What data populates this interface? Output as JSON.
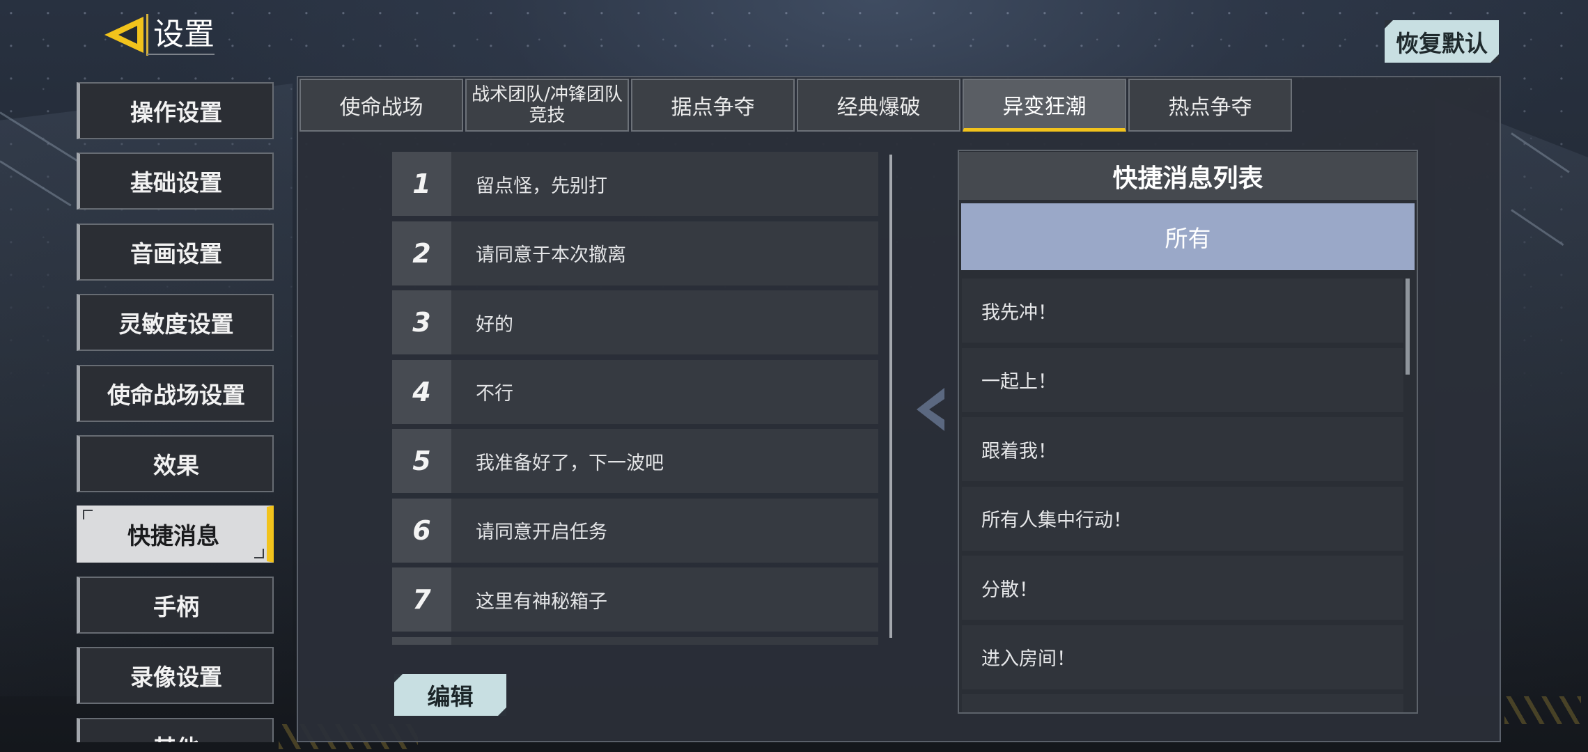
{
  "theme": {
    "accent": "#f2c31c",
    "filter_active": "#9aa8c8",
    "button_light": "#c8dfe2"
  },
  "icons": {
    "back": "back-arrow-icon",
    "move": "chevron-left-icon"
  },
  "header": {
    "title": "设置",
    "reset_label": "恢复默认"
  },
  "sidebar": {
    "items": [
      {
        "label": "操作设置"
      },
      {
        "label": "基础设置"
      },
      {
        "label": "音画设置"
      },
      {
        "label": "灵敏度设置"
      },
      {
        "label": "使命战场设置"
      },
      {
        "label": "效果"
      },
      {
        "label": "快捷消息",
        "selected": true
      },
      {
        "label": "手柄"
      },
      {
        "label": "录像设置"
      },
      {
        "label": "其他"
      }
    ]
  },
  "mode_tabs": {
    "items": [
      {
        "label": "使命战场"
      },
      {
        "label": "战术团队/冲锋团队竞技"
      },
      {
        "label": "据点争夺"
      },
      {
        "label": "经典爆破"
      },
      {
        "label": "异变狂潮",
        "selected": true
      },
      {
        "label": "热点争夺"
      }
    ]
  },
  "message_slots": [
    {
      "index": "1",
      "text": "留点怪，先别打"
    },
    {
      "index": "2",
      "text": "请同意于本次撤离"
    },
    {
      "index": "3",
      "text": "好的"
    },
    {
      "index": "4",
      "text": "不行"
    },
    {
      "index": "5",
      "text": "我准备好了，下一波吧"
    },
    {
      "index": "6",
      "text": "请同意开启任务"
    },
    {
      "index": "7",
      "text": "这里有神秘箱子"
    }
  ],
  "edit_label": "编辑",
  "quick_list": {
    "title": "快捷消息列表",
    "filter": "所有",
    "items": [
      "我先冲！",
      "一起上！",
      "跟着我！",
      "所有人集中行动！",
      "分散！",
      "进入房间！"
    ]
  }
}
